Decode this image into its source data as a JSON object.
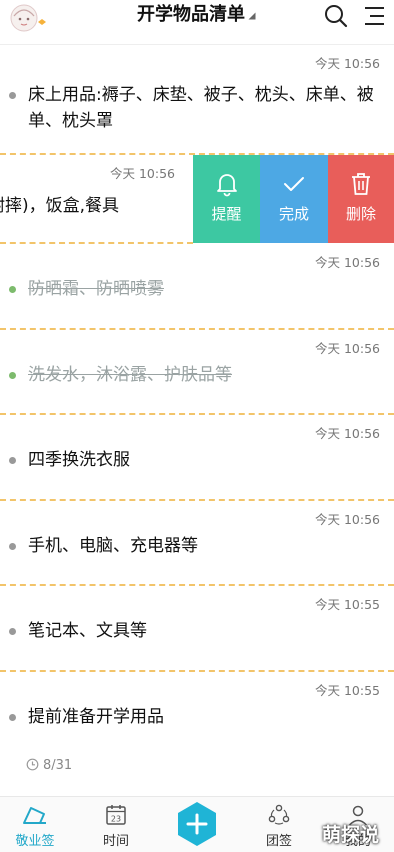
{
  "header": {
    "title": "开学物品清单"
  },
  "items": [
    {
      "time": "今天 10:56",
      "text": "床上用品:褥子、床垫、被子、枕头、床单、被单、枕头罩",
      "done": false
    },
    {
      "time": "今天 10:56",
      "text": "耐摔)，饭盒,餐具",
      "done": false,
      "swiped": true
    },
    {
      "time": "今天 10:56",
      "text": "防晒霜、防晒喷雾",
      "done": true
    },
    {
      "time": "今天 10:56",
      "text": "洗发水，沐浴露、护肤品等",
      "done": true
    },
    {
      "time": "今天 10:56",
      "text": "四季换洗衣服",
      "done": false
    },
    {
      "time": "今天 10:56",
      "text": "手机、电脑、充电器等",
      "done": false
    },
    {
      "time": "今天 10:55",
      "text": "笔记本、文具等",
      "done": false
    },
    {
      "time": "今天 10:55",
      "text": "提前准备开学用品",
      "done": false,
      "date": "8/31"
    }
  ],
  "swipe_actions": {
    "remind": "提醒",
    "complete": "完成",
    "delete": "删除"
  },
  "colors": {
    "remind": "#3dc8a2",
    "complete": "#4da8e4",
    "delete": "#e85e5a",
    "accent": "#23a8c9",
    "divider": "#f2c46a"
  },
  "nav": {
    "notes": "敬业签",
    "time": "时间",
    "team": "团签",
    "mine": "我的",
    "calendar_day": "23"
  },
  "watermark": "萌探说"
}
